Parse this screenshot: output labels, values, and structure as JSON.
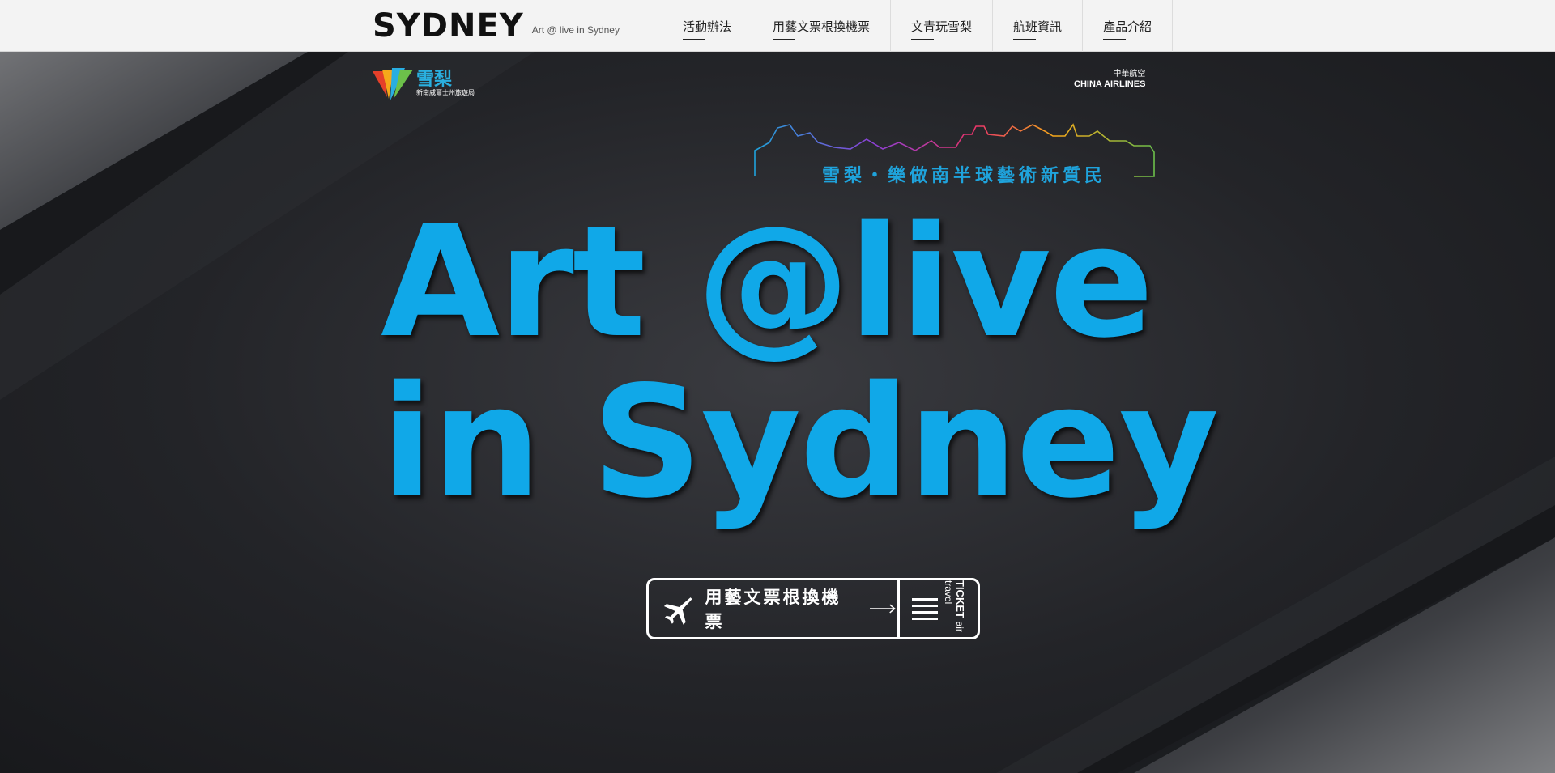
{
  "header": {
    "logo_text": "SYDNEY",
    "subtitle": "Art @ live in Sydney",
    "nav": [
      {
        "label": "活動辦法"
      },
      {
        "label": "用藝文票根換機票"
      },
      {
        "label": "文青玩雪梨"
      },
      {
        "label": "航班資訊"
      },
      {
        "label": "產品介紹"
      }
    ]
  },
  "hero": {
    "partner_left": {
      "title": "雪梨",
      "subtitle": "新南威爾士州旅遊局"
    },
    "partner_right": {
      "cn": "中華航空",
      "en": "CHINA AIRLINES"
    },
    "tagline": "雪梨・樂做南半球藝術新質民",
    "headline_line1": "Art @live",
    "headline_line2": "in Sydney",
    "cta": {
      "label": "用藝文票根換機票",
      "side_top": "TICKET",
      "side_bottom": "air travel"
    }
  },
  "colors": {
    "accent": "#10a8e8",
    "background": "#232428"
  }
}
